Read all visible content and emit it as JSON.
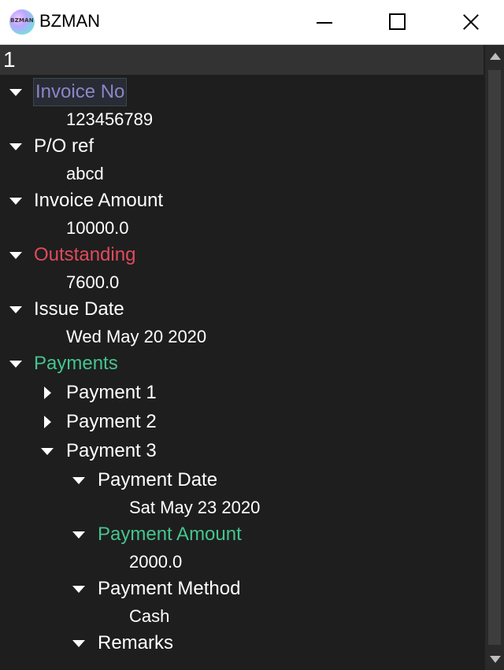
{
  "window": {
    "title": "BZMAN",
    "logo_text": "BZMAN"
  },
  "header": {
    "text": "1"
  },
  "colors": {
    "highlight_purple": "#8c86c8",
    "alert_red": "#e04b5c",
    "accent_green": "#45c48f",
    "default_white": "#ffffff"
  },
  "tree": {
    "invoice_no": {
      "label": "Invoice No",
      "value": "123456789"
    },
    "po_ref": {
      "label": "P/O ref",
      "value": "abcd"
    },
    "invoice_amount": {
      "label": "Invoice Amount",
      "value": "10000.0"
    },
    "outstanding": {
      "label": "Outstanding",
      "value": "7600.0"
    },
    "issue_date": {
      "label": "Issue Date",
      "value": "Wed May 20 2020"
    },
    "payments": {
      "label": "Payments",
      "payment1": {
        "label": "Payment 1"
      },
      "payment2": {
        "label": "Payment 2"
      },
      "payment3": {
        "label": "Payment 3",
        "date": {
          "label": "Payment Date",
          "value": "Sat May 23 2020"
        },
        "amount": {
          "label": "Payment Amount",
          "value": "2000.0"
        },
        "method": {
          "label": "Payment Method",
          "value": "Cash"
        },
        "remarks": {
          "label": "Remarks"
        }
      }
    }
  }
}
